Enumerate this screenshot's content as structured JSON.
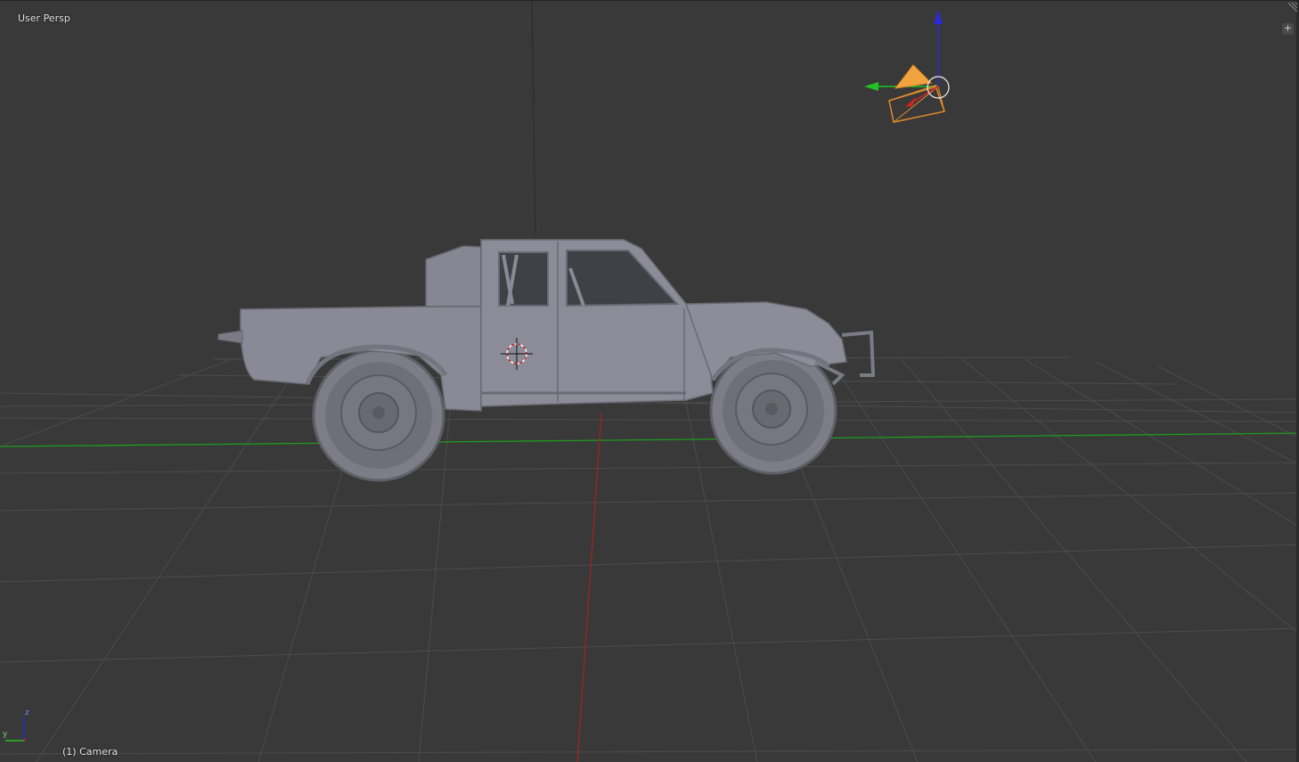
{
  "viewport": {
    "view_name": "User Persp",
    "active_object": "(1) Camera",
    "corner_button_symbol": "+"
  },
  "scene": {
    "model": "off-road trophy truck",
    "shading": "solid",
    "grid": true,
    "x_axis_color": "#9c2424",
    "y_axis_color": "#1f9a1f",
    "grid_color": "#4c4c4c"
  },
  "camera_gizmo": {
    "camera_color": "#e38b2a",
    "z_arrow_color": "#2b2bd6",
    "y_arrow_color": "#22c222",
    "x_arrow_color": "#d42222"
  },
  "mini_axes": {
    "z_label": "z",
    "y_label": "y"
  }
}
